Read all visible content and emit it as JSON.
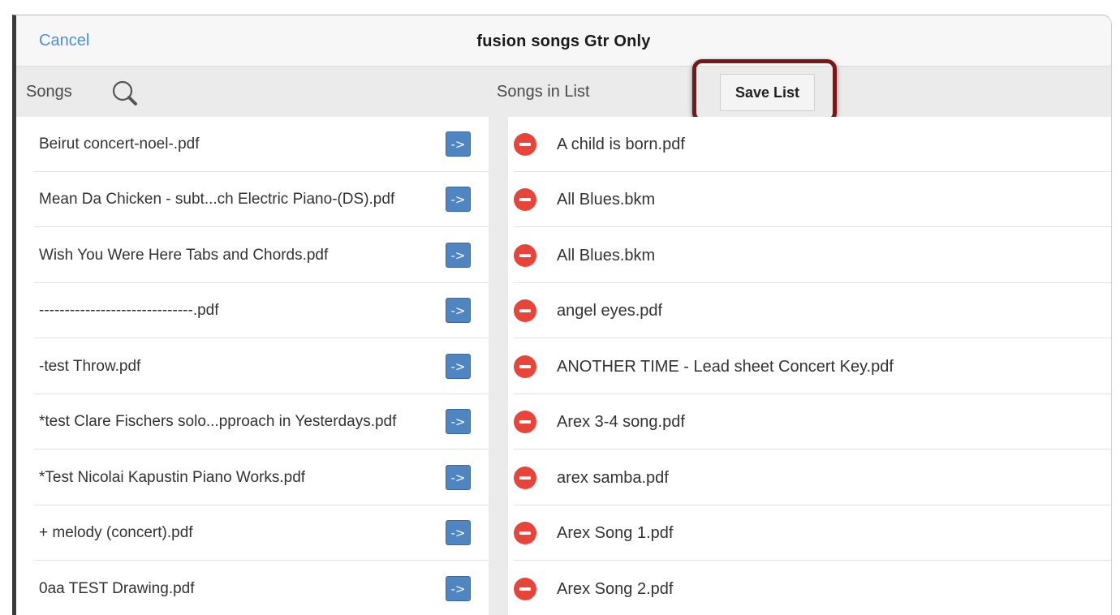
{
  "dialog": {
    "cancel_label": "Cancel",
    "title": "fusion songs Gtr Only"
  },
  "header": {
    "songs_label": "Songs",
    "search_icon": "search-icon",
    "songs_in_list_label": "Songs in List",
    "save_list_label": "Save List"
  },
  "available_songs": {
    "add_button_label": "->",
    "items": [
      {
        "name": "Beirut concert-noel-.pdf"
      },
      {
        "name": "Mean Da Chicken - subt...ch Electric Piano-(DS).pdf"
      },
      {
        "name": "Wish You Were Here Tabs and Chords.pdf"
      },
      {
        "name": "------------------------------.pdf"
      },
      {
        "name": "-test Throw.pdf"
      },
      {
        "name": "*test Clare Fischers solo...pproach in Yesterdays.pdf"
      },
      {
        "name": "*Test Nicolai Kapustin Piano Works.pdf"
      },
      {
        "name": "+ melody (concert).pdf"
      },
      {
        "name": "0aa TEST Drawing.pdf"
      }
    ]
  },
  "list_songs": {
    "remove_icon": "minus-circle-icon",
    "items": [
      {
        "name": "A child is born.pdf"
      },
      {
        "name": "All Blues.bkm"
      },
      {
        "name": "All Blues.bkm"
      },
      {
        "name": "angel eyes.pdf"
      },
      {
        "name": "ANOTHER TIME - Lead sheet Concert Key.pdf"
      },
      {
        "name": "Arex 3-4 song.pdf"
      },
      {
        "name": "arex samba.pdf"
      },
      {
        "name": "Arex Song 1.pdf"
      },
      {
        "name": "Arex Song 2.pdf"
      }
    ]
  },
  "colors": {
    "accent": "#4a90e2",
    "add_button": "#4f86c2",
    "remove_icon": "#e8443a",
    "highlight_border": "#7a1518"
  }
}
